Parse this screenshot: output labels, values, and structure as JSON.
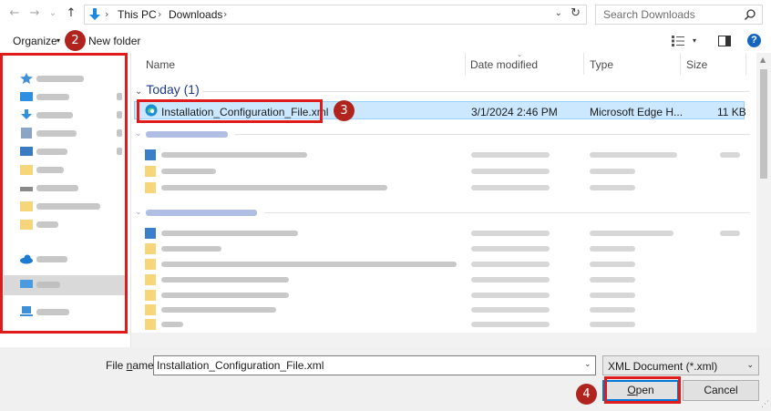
{
  "address_bar": {
    "back_glyph": "←",
    "forward_glyph": "→",
    "recent_glyph": "⌄",
    "up_glyph": "↑",
    "crumbs": [
      "This PC",
      "Downloads"
    ],
    "sep_glyph": "›",
    "dropdown_glyph": "⌄",
    "refresh_glyph": "↻",
    "search_placeholder": "Search Downloads"
  },
  "command_bar": {
    "organize_label": "Organize",
    "caret_glyph": "▾",
    "new_folder_label": "New folder",
    "help_label": "?"
  },
  "columns": {
    "name": "Name",
    "date_modified": "Date modified",
    "type": "Type",
    "size": "Size",
    "sort_glyph": "⌄"
  },
  "group": {
    "chevron": "⌄",
    "label": "Today (1)"
  },
  "selected_file": {
    "icon": "edge-xml-icon",
    "name": "Installation_Configuration_File.xml",
    "date": "3/1/2024 2:46 PM",
    "type": "Microsoft Edge H...",
    "size": "11 KB"
  },
  "bottom": {
    "file_name_label_pre": "File ",
    "file_name_label_u": "n",
    "file_name_label_post": "ame:",
    "file_name_value": "Installation_Configuration_File.xml",
    "file_name_caret": "⌄",
    "file_type_value": "XML Document (*.xml)",
    "file_type_caret": "⌄",
    "open_label_u": "O",
    "open_label_rest": "pen",
    "cancel_label": "Cancel",
    "grip_glyph": "⋰"
  },
  "annotations": [
    "2",
    "3",
    "4"
  ],
  "colors": {
    "annotation_red": "#e01b1b",
    "annotation_marker": "#b1241e",
    "selection_bg": "#cce8ff",
    "accent_blue": "#0078d7"
  }
}
